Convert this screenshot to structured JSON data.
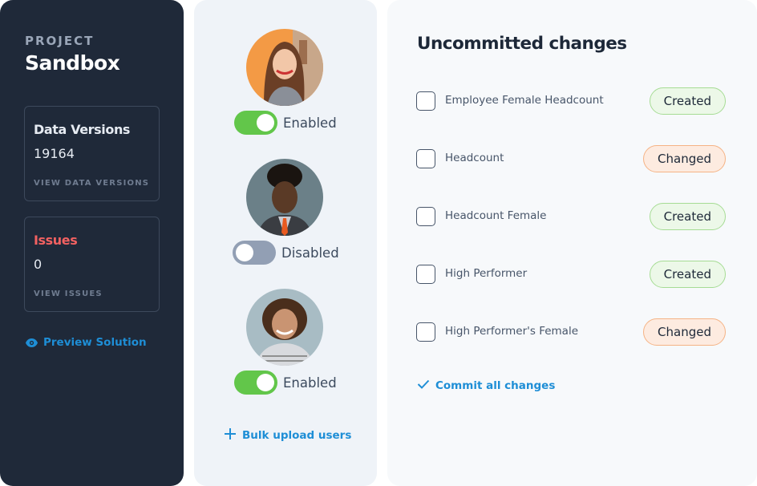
{
  "sidebar": {
    "project_label": "PROJECT",
    "project_name": "Sandbox",
    "data_versions": {
      "title": "Data Versions",
      "value": "19164",
      "link": "VIEW DATA VERSIONS"
    },
    "issues": {
      "title": "Issues",
      "value": "0",
      "link": "VIEW ISSUES"
    },
    "preview_link": "Preview Solution"
  },
  "users": {
    "items": [
      {
        "status": "Enabled",
        "enabled": true
      },
      {
        "status": "Disabled",
        "enabled": false
      },
      {
        "status": "Enabled",
        "enabled": true
      }
    ],
    "bulk_upload": "Bulk upload users"
  },
  "changes": {
    "title": "Uncommitted changes",
    "items": [
      {
        "label": "Employee Female Headcount",
        "status": "Created"
      },
      {
        "label": "Headcount",
        "status": "Changed"
      },
      {
        "label": "Headcount Female",
        "status": "Created"
      },
      {
        "label": "High Performer",
        "status": "Created"
      },
      {
        "label": "High Performer's Female",
        "status": "Changed"
      }
    ],
    "commit_all": "Commit all changes"
  },
  "colors": {
    "sidebar_bg": "#1f2939",
    "accent_blue": "#1e8ed6",
    "issues_red": "#f26161",
    "toggle_on": "#62c64a",
    "toggle_off": "#929fb4",
    "created_bg": "#ecf8e8",
    "changed_bg": "#fdebe0"
  }
}
